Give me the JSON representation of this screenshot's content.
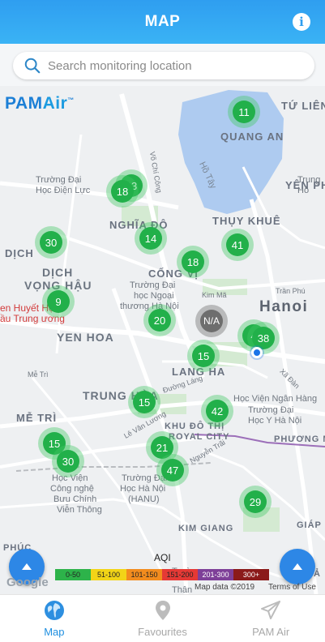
{
  "header": {
    "title": "MAP",
    "info_icon": "info-icon"
  },
  "search": {
    "placeholder": "Search monitoring location",
    "icon": "search-icon"
  },
  "logo": {
    "part1": "PAM",
    "part2": "Air",
    "tm": "™"
  },
  "map_labels": [
    {
      "text": "TỨ LIÊN",
      "style": "big"
    },
    {
      "text": "QUANG AN",
      "style": "big"
    },
    {
      "text": "YÊN PHỤ",
      "style": "big"
    },
    {
      "text": "Trường Đại",
      "style": ""
    },
    {
      "text": "Học Điện Lực",
      "style": ""
    },
    {
      "text": "Hồ Tây",
      "style": "lake"
    },
    {
      "text": "THỤY KHUÊ",
      "style": "big"
    },
    {
      "text": "NGHĨA ĐÔ",
      "style": "big"
    },
    {
      "text": "DỊCH",
      "style": "big"
    },
    {
      "text": "DỊCH",
      "style": "district"
    },
    {
      "text": "VỌNG HẬU",
      "style": "district"
    },
    {
      "text": "CỐNG VỊ",
      "style": "big"
    },
    {
      "text": "Trường Đại",
      "style": ""
    },
    {
      "text": "học Ngoại",
      "style": ""
    },
    {
      "text": "thương Hà Nội",
      "style": ""
    },
    {
      "text": "Kim Mã",
      "style": ""
    },
    {
      "text": "Hanoi",
      "style": "city"
    },
    {
      "text": "en Huyết Học",
      "style": "red"
    },
    {
      "text": "ầu Trung ương",
      "style": "red"
    },
    {
      "text": "YEN HOA",
      "style": "district"
    },
    {
      "text": "LANG HA",
      "style": "big"
    },
    {
      "text": "TRUNG HÒA",
      "style": "district"
    },
    {
      "text": "MỄ TRÌ",
      "style": "big"
    },
    {
      "text": "Học Viện Ngân Hàng",
      "style": ""
    },
    {
      "text": "Trường Đại",
      "style": ""
    },
    {
      "text": "Học Y Hà Nội",
      "style": ""
    },
    {
      "text": "KHU ĐÔ THỊ",
      "style": "big"
    },
    {
      "text": "ROYAL CITY",
      "style": "big"
    },
    {
      "text": "PHƯƠNG MAI",
      "style": "big"
    },
    {
      "text": "Học Viện",
      "style": ""
    },
    {
      "text": "Công nghệ",
      "style": ""
    },
    {
      "text": "Bưu Chính",
      "style": ""
    },
    {
      "text": "Viễn Thông",
      "style": ""
    },
    {
      "text": "Trường Đại",
      "style": ""
    },
    {
      "text": "Học Hà Nội",
      "style": ""
    },
    {
      "text": "(HANU)",
      "style": ""
    },
    {
      "text": "KIM GIANG",
      "style": "big"
    },
    {
      "text": "GIÁP",
      "style": "big"
    },
    {
      "text": "PHÚC",
      "style": "big"
    },
    {
      "text": "Trường",
      "style": ""
    },
    {
      "text": "Thân",
      "style": ""
    },
    {
      "text": "HẢ",
      "style": "big"
    },
    {
      "text": "Trung",
      "style": ""
    },
    {
      "text": "Hồ",
      "style": ""
    },
    {
      "text": "Trần Phú",
      "style": ""
    },
    {
      "text": "Đường Láng",
      "style": ""
    },
    {
      "text": "Mễ Trì",
      "style": ""
    },
    {
      "text": "Võ Chí Công",
      "style": ""
    },
    {
      "text": "Lê Văn Lương",
      "style": ""
    },
    {
      "text": "Nguyễn Trãi",
      "style": ""
    },
    {
      "text": "Xã Đàn",
      "style": ""
    }
  ],
  "markers": [
    {
      "value": "11"
    },
    {
      "value": "33"
    },
    {
      "value": "18"
    },
    {
      "value": "30"
    },
    {
      "value": "14"
    },
    {
      "value": "41"
    },
    {
      "value": "18"
    },
    {
      "value": "9"
    },
    {
      "value": "20"
    },
    {
      "value": "N/A"
    },
    {
      "value": "4"
    },
    {
      "value": "38"
    },
    {
      "value": "15"
    },
    {
      "value": "15"
    },
    {
      "value": "42"
    },
    {
      "value": "15"
    },
    {
      "value": "30"
    },
    {
      "value": "21"
    },
    {
      "value": "47"
    },
    {
      "value": "29"
    }
  ],
  "aqi": {
    "title": "AQI",
    "legend": [
      {
        "label": "0-50",
        "color": "#2db34a"
      },
      {
        "label": "51-100",
        "color": "#f2d417"
      },
      {
        "label": "101-150",
        "color": "#f28c1e"
      },
      {
        "label": "151-200",
        "color": "#e53935"
      },
      {
        "label": "201-300",
        "color": "#7e3f98"
      },
      {
        "label": "300+",
        "color": "#8b1a1a"
      }
    ]
  },
  "map_footer": {
    "google": "Google",
    "map_data": "Map data ©2019",
    "terms": "Terms of Use"
  },
  "tabs": [
    {
      "label": "Map",
      "icon": "globe-icon",
      "active": true
    },
    {
      "label": "Favourites",
      "icon": "location-pin-icon",
      "active": false
    },
    {
      "label": "PAM Air",
      "icon": "paper-plane-icon",
      "active": false
    }
  ],
  "colors": {
    "accent": "#2f9ef0",
    "marker_green": "#22b04a",
    "marker_na": "#6e6e6e"
  }
}
